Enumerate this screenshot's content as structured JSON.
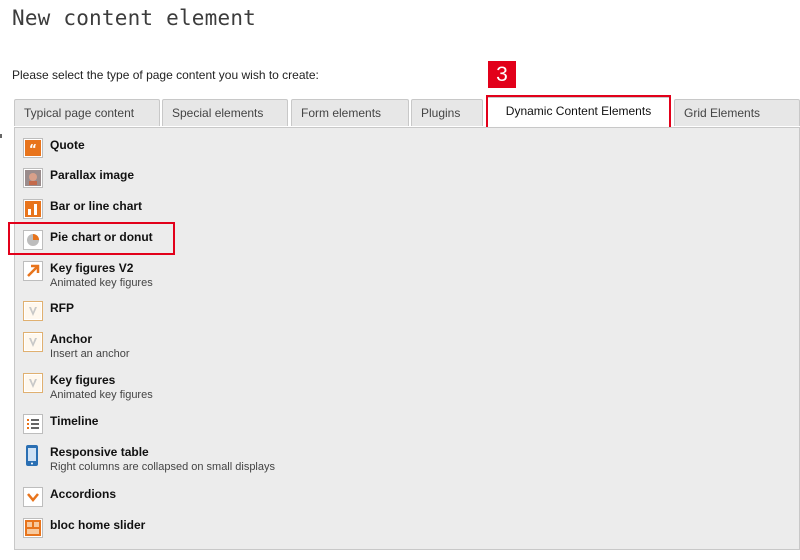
{
  "page": {
    "title": "New content element",
    "instruction": "Please select the type of page content you wish to create:",
    "step_badge": "3"
  },
  "tabs": [
    {
      "label": "Typical page content"
    },
    {
      "label": "Special elements"
    },
    {
      "label": "Form elements"
    },
    {
      "label": "Plugins"
    },
    {
      "label": "Dynamic Content Elements",
      "active": true
    },
    {
      "label": "Grid Elements"
    }
  ],
  "items": [
    {
      "title": "Quote",
      "description": "",
      "icon": "quote-icon"
    },
    {
      "title": "Parallax image",
      "description": "",
      "icon": "parallax-image-icon"
    },
    {
      "title": "Bar or line chart",
      "description": "",
      "icon": "bar-chart-icon"
    },
    {
      "title": "Pie chart or donut",
      "description": "",
      "icon": "pie-chart-icon",
      "highlighted": true
    },
    {
      "title": "Key figures V2",
      "description": "Animated key figures",
      "icon": "arrow-up-right-icon"
    },
    {
      "title": "RFP",
      "description": "",
      "icon": "typo3-icon"
    },
    {
      "title": "Anchor",
      "description": "Insert an anchor",
      "icon": "typo3-icon"
    },
    {
      "title": "Key figures",
      "description": "Animated key figures",
      "icon": "typo3-icon"
    },
    {
      "title": "Timeline",
      "description": "",
      "icon": "timeline-list-icon"
    },
    {
      "title": "Responsive table",
      "description": "Right columns are collapsed on small displays",
      "icon": "mobile-device-icon"
    },
    {
      "title": "Accordions",
      "description": "",
      "icon": "chevron-down-icon"
    },
    {
      "title": "bloc home slider",
      "description": "",
      "icon": "slider-grid-icon"
    }
  ],
  "colors": {
    "accent": "#e2001a",
    "icon_orange": "#e8741c",
    "panel_bg": "#ececec",
    "tab_bg": "#e7e7e7"
  }
}
